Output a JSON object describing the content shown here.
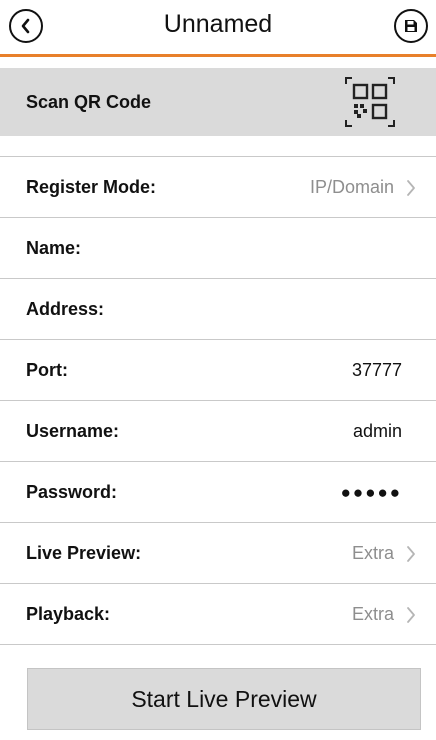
{
  "header": {
    "title": "Unnamed",
    "accent_color": "#e8802a",
    "back_icon": "chevron-left-icon",
    "save_icon": "save-icon"
  },
  "qr": {
    "label": "Scan QR Code",
    "icon": "qr-code-icon"
  },
  "rows": [
    {
      "label": "Register Mode:",
      "value": "IP/Domain",
      "muted": true,
      "chevron": true
    },
    {
      "label": "Name:",
      "value": ""
    },
    {
      "label": "Address:",
      "value": ""
    },
    {
      "label": "Port:",
      "value": "37777"
    },
    {
      "label": "Username:",
      "value": "admin"
    },
    {
      "label": "Password:",
      "value": "●●●●●"
    },
    {
      "label": "Live Preview:",
      "value": "Extra",
      "muted": true,
      "chevron": true
    },
    {
      "label": "Playback:",
      "value": "Extra",
      "muted": true,
      "chevron": true
    }
  ],
  "footer": {
    "start_label": "Start Live Preview"
  }
}
